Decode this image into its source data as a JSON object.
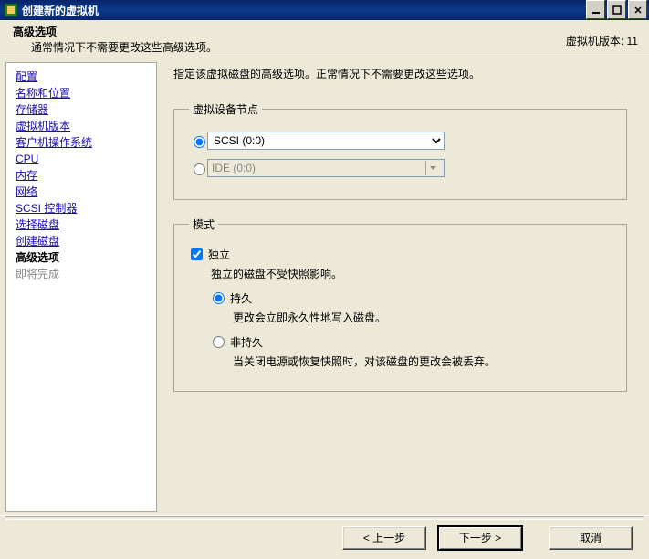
{
  "titlebar": {
    "title": "创建新的虚拟机"
  },
  "header": {
    "heading": "高级选项",
    "sub": "通常情况下不需要更改这些高级选项。",
    "version": "虚拟机版本: 11"
  },
  "sidebar": {
    "steps": [
      "配置",
      "名称和位置",
      "存储器",
      "虚拟机版本",
      "客户机操作系统",
      "CPU",
      "内存",
      "网络",
      "SCSI 控制器",
      "选择磁盘",
      "创建磁盘"
    ],
    "current": "高级选项",
    "future": "即将完成"
  },
  "main": {
    "intro": "指定该虚拟磁盘的高级选项。正常情况下不需要更改这些选项。",
    "device_node": {
      "legend": "虚拟设备节点",
      "scsi": {
        "selected": true,
        "value": "SCSI (0:0)"
      },
      "ide": {
        "selected": false,
        "value": "IDE (0:0)"
      }
    },
    "mode": {
      "legend": "模式",
      "independent": {
        "checked": true,
        "label": "独立",
        "desc": "独立的磁盘不受快照影响。"
      },
      "persistent": {
        "selected": true,
        "label": "持久",
        "desc": "更改会立即永久性地写入磁盘。"
      },
      "nonpersistent": {
        "selected": false,
        "label": "非持久",
        "desc": "当关闭电源或恢复快照时，对该磁盘的更改会被丢弃。"
      }
    }
  },
  "footer": {
    "back": "< 上一步",
    "next": "下一步 >",
    "cancel": "取消"
  }
}
